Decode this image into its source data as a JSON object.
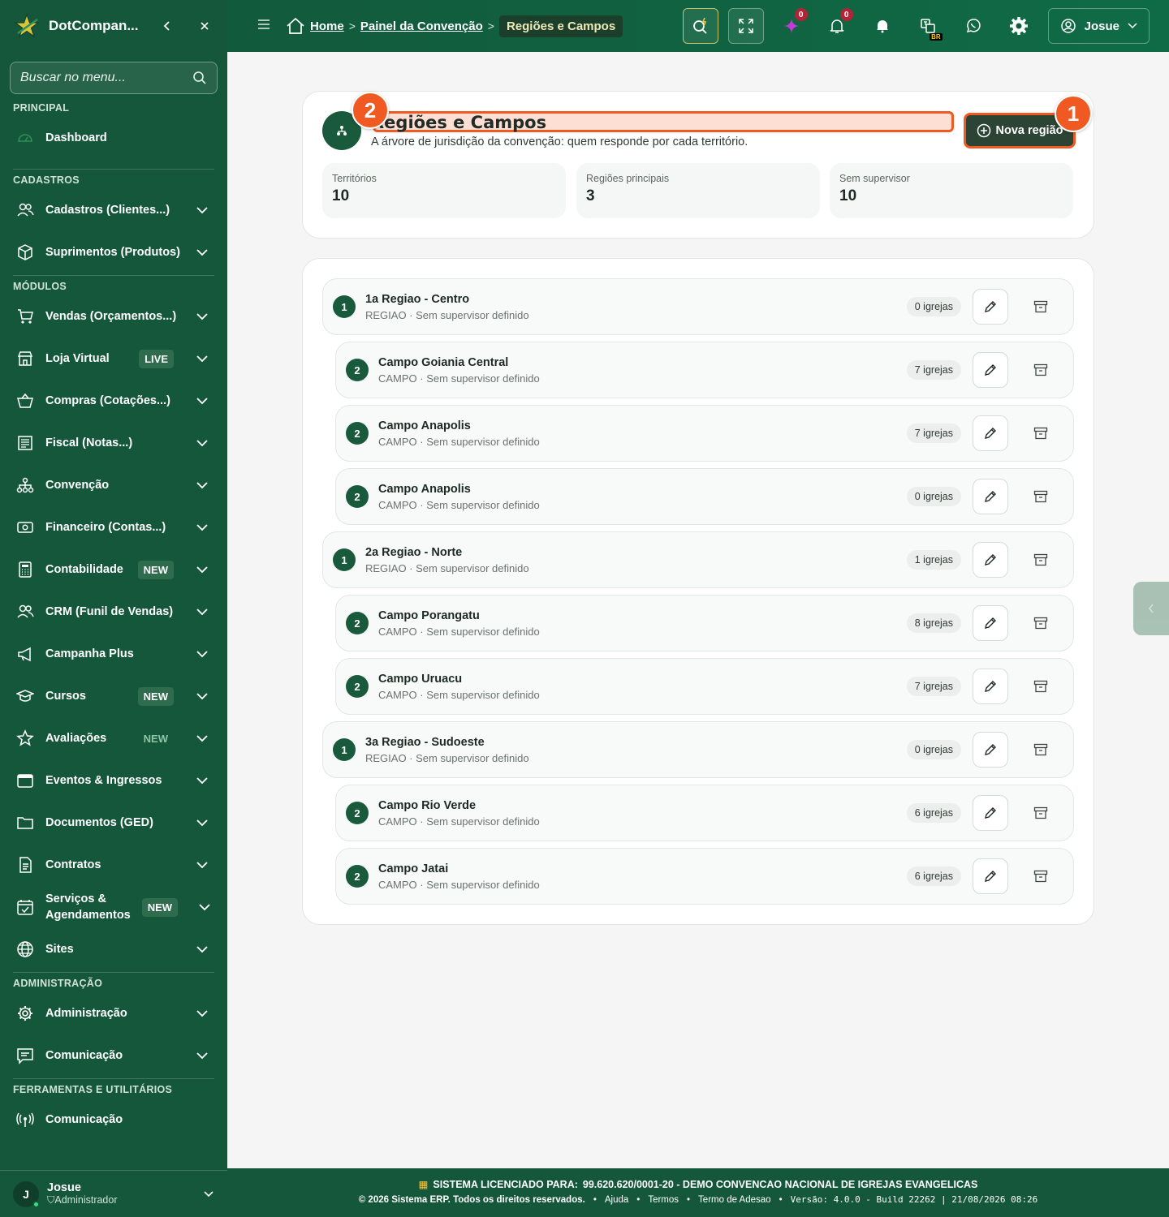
{
  "sidebar": {
    "brand": "DotCompan...",
    "search_placeholder": "Buscar no menu...",
    "sections": {
      "principal": "PRINCIPAL",
      "cadastros": "CADASTROS",
      "modulos": "MÓDULOS",
      "administracao": "ADMINISTRAÇÃO",
      "ferramentas": "FERRAMENTAS E UTILITÁRIOS"
    },
    "items": {
      "dashboard": "Dashboard",
      "cadastros": "Cadastros (Clientes...)",
      "suprimentos": "Suprimentos (Produtos)",
      "vendas": "Vendas (Orçamentos...)",
      "loja": "Loja Virtual",
      "compras": "Compras (Cotações...)",
      "fiscal": "Fiscal (Notas...)",
      "convencao": "Convenção",
      "financeiro": "Financeiro (Contas...)",
      "contabilidade": "Contabilidade",
      "crm": "CRM (Funil de Vendas)",
      "campanha": "Campanha Plus",
      "cursos": "Cursos",
      "avaliacoes": "Avaliações",
      "eventos": "Eventos & Ingressos",
      "documentos": "Documentos (GED)",
      "contratos": "Contratos",
      "servicos": "Serviços & Agendamentos",
      "sites": "Sites",
      "administracao": "Administração",
      "comunicacao_admin": "Comunicação",
      "comunicacao_tools": "Comunicação"
    },
    "badges": {
      "live": "LIVE",
      "new": "NEW"
    },
    "user": {
      "initial": "J",
      "name": "Josue",
      "role": "Administrador"
    }
  },
  "topbar": {
    "breadcrumb": {
      "home": "Home",
      "painel": "Painel da Convenção",
      "current": "Regiões e Campos"
    },
    "ai_count": "0",
    "notif_count": "0",
    "lang_badge": "BR",
    "user_name": "Josue"
  },
  "page": {
    "title": "Regiões e Campos",
    "subtitle": "A árvore de jurisdição da convenção: quem responde por cada território.",
    "new_button": "Nova região",
    "markers": {
      "one": "1",
      "two": "2"
    },
    "stats": [
      {
        "label": "Territórios",
        "value": "10"
      },
      {
        "label": "Regiões principais",
        "value": "3"
      },
      {
        "label": "Sem supervisor",
        "value": "10"
      }
    ],
    "rows": [
      {
        "level": "1",
        "name": "1a Regiao - Centro",
        "meta": "REGIAO · Sem supervisor definido",
        "count": "0 igrejas"
      },
      {
        "level": "2",
        "name": "Campo Goiania Central",
        "meta": "CAMPO · Sem supervisor definido",
        "count": "7 igrejas"
      },
      {
        "level": "2",
        "name": "Campo Anapolis",
        "meta": "CAMPO · Sem supervisor definido",
        "count": "7 igrejas"
      },
      {
        "level": "2",
        "name": "Campo Anapolis",
        "meta": "CAMPO · Sem supervisor definido",
        "count": "0 igrejas"
      },
      {
        "level": "1",
        "name": "2a Regiao - Norte",
        "meta": "REGIAO · Sem supervisor definido",
        "count": "1 igrejas"
      },
      {
        "level": "2",
        "name": "Campo Porangatu",
        "meta": "CAMPO · Sem supervisor definido",
        "count": "8 igrejas"
      },
      {
        "level": "2",
        "name": "Campo Uruacu",
        "meta": "CAMPO · Sem supervisor definido",
        "count": "7 igrejas"
      },
      {
        "level": "1",
        "name": "3a Regiao - Sudoeste",
        "meta": "REGIAO · Sem supervisor definido",
        "count": "0 igrejas"
      },
      {
        "level": "2",
        "name": "Campo Rio Verde",
        "meta": "CAMPO · Sem supervisor definido",
        "count": "6 igrejas"
      },
      {
        "level": "2",
        "name": "Campo Jatai",
        "meta": "CAMPO · Sem supervisor definido",
        "count": "6 igrejas"
      }
    ]
  },
  "footer": {
    "license_label": "SISTEMA LICENCIADO PARA:",
    "license_value": "99.620.620/0001-20 - DEMO CONVENCAO NACIONAL DE IGREJAS EVANGELICAS",
    "copyright": "© 2026 Sistema ERP. Todos os direitos reservados.",
    "ajuda": "Ajuda",
    "termos": "Termos",
    "adesao": "Termo de Adesao",
    "version": "Versão: 4.0.0 - Build 22262 | 21/08/2026 08:26"
  },
  "colors": {
    "primary": "#15573a",
    "accent": "#f05a22",
    "badge_red": "#b42335"
  }
}
